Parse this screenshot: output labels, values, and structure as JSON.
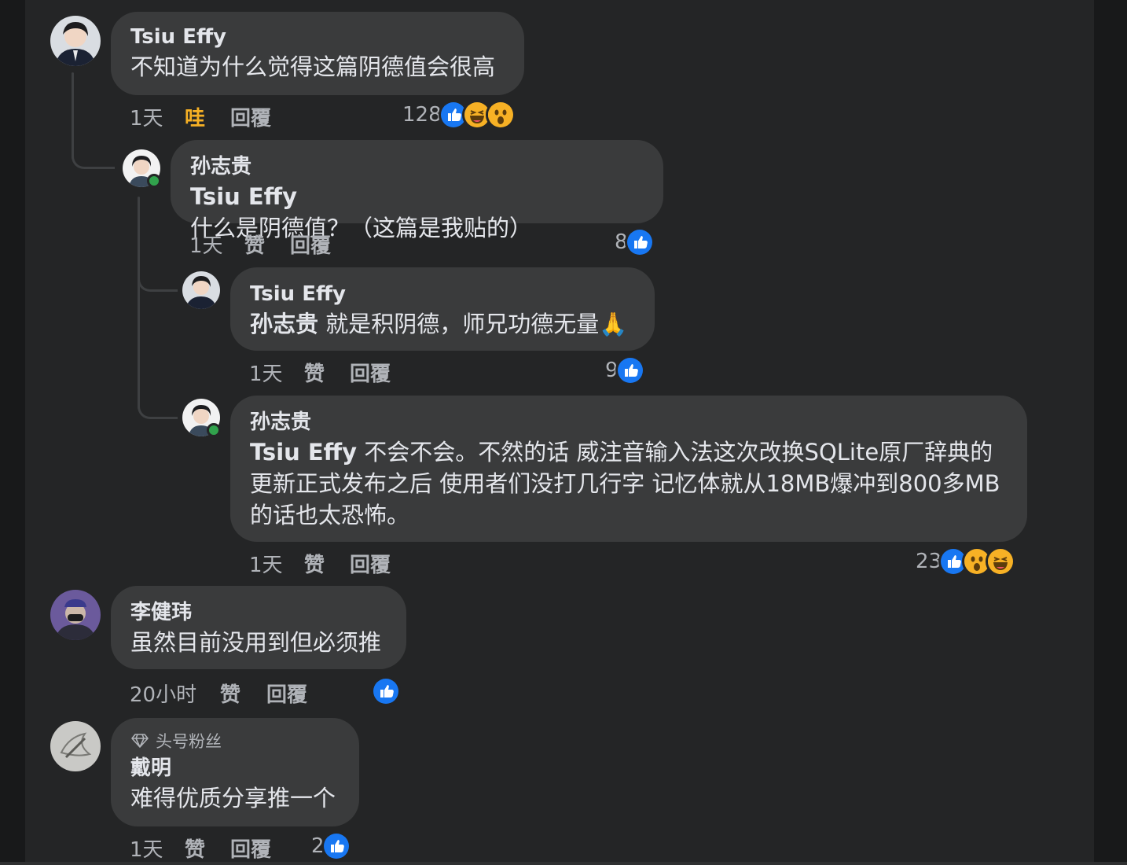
{
  "labels": {
    "like": "赞",
    "wow": "哇",
    "reply": "回覆"
  },
  "colors": {
    "background": "#18191a",
    "panel": "#242526",
    "bubble": "#3a3b3c",
    "text": "#e4e6eb",
    "secondary_text": "#b0b3b8",
    "like_blue": "#1877f2",
    "wow_yellow": "#f7b125",
    "online_green": "#31a24c"
  },
  "comments": [
    {
      "author": "Tsiu Effy",
      "text": "不知道为什么觉得这篇阴德值会很高",
      "time": "1天",
      "reaction_label": "哇",
      "reaction_count": "128",
      "reaction_icons": [
        "like-icon",
        "laugh-icon",
        "wow-icon"
      ]
    },
    {
      "author": "孙志贵",
      "mention": "Tsiu Effy",
      "text": " 什么是阴德值？（这篇是我贴的）",
      "time": "1天",
      "reaction_label": "赞",
      "reaction_count": "8",
      "reaction_icons": [
        "like-icon"
      ],
      "online": true
    },
    {
      "author": "Tsiu Effy",
      "mention": "孙志贵",
      "text": " 就是积阴德，师兄功德无量🙏",
      "time": "1天",
      "reaction_label": "赞",
      "reaction_count": "9",
      "reaction_icons": [
        "like-icon"
      ]
    },
    {
      "author": "孙志贵",
      "mention": "Tsiu Effy",
      "text": " 不会不会。不然的话 威注音输入法这次改换SQLite原厂辞典的更新正式发布之后 使用者们没打几行字 记忆体就从18MB爆冲到800多MB的话也太恐怖。",
      "time": "1天",
      "reaction_label": "赞",
      "reaction_count": "23",
      "reaction_icons": [
        "like-icon",
        "wow-icon",
        "laugh-icon"
      ],
      "online": true
    },
    {
      "author": "李健玮",
      "text": "虽然目前没用到但必须推",
      "time": "20小时",
      "reaction_label": "赞",
      "reaction_count": "",
      "reaction_icons": [
        "like-icon"
      ]
    },
    {
      "badge": "头号粉丝",
      "author": "戴明",
      "text": "难得优质分享推一个",
      "time": "1天",
      "reaction_label": "赞",
      "reaction_count": "2",
      "reaction_icons": [
        "like-icon"
      ]
    }
  ]
}
